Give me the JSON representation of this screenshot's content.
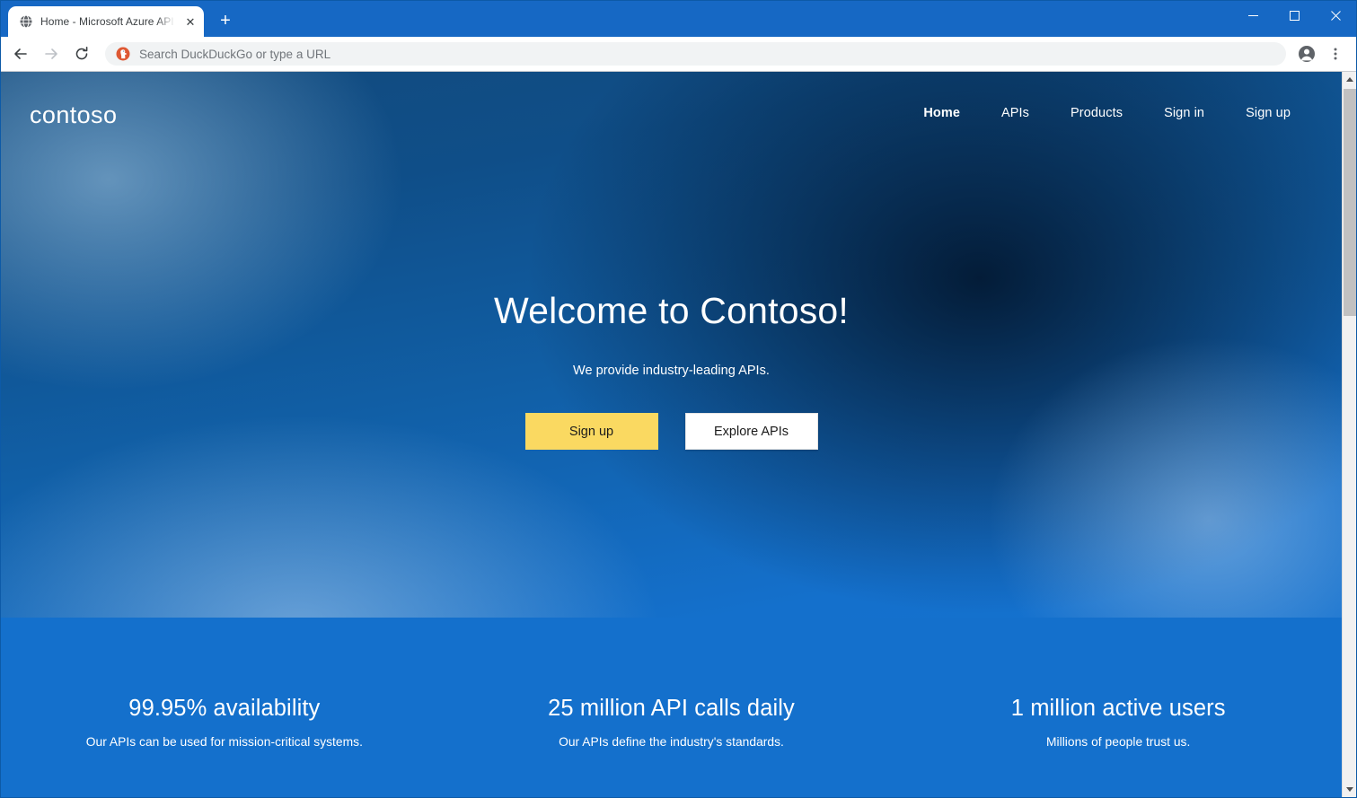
{
  "browser": {
    "tab": {
      "title": "Home - Microsoft Azure API Man",
      "favicon": "globe-icon",
      "close_label": "✕"
    },
    "new_tab_label": "+",
    "window_controls": {
      "minimize": "minimize-icon",
      "maximize": "maximize-icon",
      "close": "close-icon"
    },
    "toolbar": {
      "back": "back-arrow-icon",
      "forward": "forward-arrow-icon",
      "reload": "reload-icon",
      "omnibox_placeholder": "Search DuckDuckGo or type a URL",
      "omnibox_value": "",
      "search_engine_icon": "duckduckgo-icon",
      "profile": "profile-avatar-icon",
      "menu": "three-dot-menu-icon"
    },
    "scrollbar": {
      "up": "scroll-up-arrow-icon",
      "down": "scroll-down-arrow-icon"
    }
  },
  "site": {
    "brand": "contoso",
    "nav": [
      {
        "label": "Home",
        "active": true
      },
      {
        "label": "APIs",
        "active": false
      },
      {
        "label": "Products",
        "active": false
      },
      {
        "label": "Sign in",
        "active": false
      },
      {
        "label": "Sign up",
        "active": false
      }
    ],
    "hero": {
      "title": "Welcome to Contoso!",
      "subtitle": "We provide industry-leading APIs.",
      "primary_cta": "Sign up",
      "secondary_cta": "Explore APIs"
    },
    "stats": [
      {
        "value": "99.95% availability",
        "description": "Our APIs can be used for mission-critical systems."
      },
      {
        "value": "25 million API calls daily",
        "description": "Our APIs define the industry's standards."
      },
      {
        "value": "1 million active users",
        "description": "Millions of people trust us."
      }
    ]
  },
  "colors": {
    "browser_frame": "#1668c4",
    "hero_dark": "#0a2238",
    "hero_blue": "#1470cc",
    "stats_band": "#1470cc",
    "cta_primary": "#fad961",
    "cta_secondary": "#ffffff",
    "text_on_hero": "#ffffff"
  }
}
